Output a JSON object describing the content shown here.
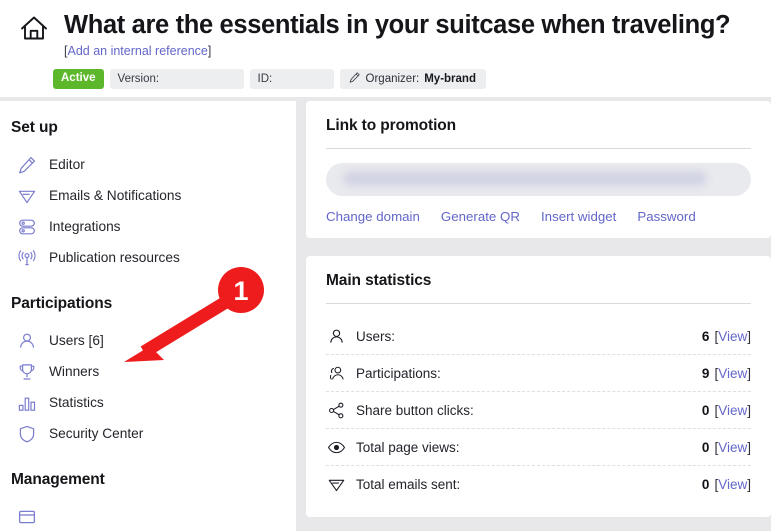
{
  "header": {
    "home_icon": "home-icon",
    "title": "What are the essentials in your suitcase when traveling?",
    "internal_ref_open": "[",
    "internal_ref_link": "Add an internal reference",
    "internal_ref_close": "]",
    "status_badge": "Active",
    "status_color": "#5cb82a",
    "version_label": "Version:",
    "id_label": "ID:",
    "organizer_icon": "pencil-icon",
    "organizer_label": "Organizer:",
    "organizer_value": "My-brand"
  },
  "sidebar": {
    "groups": [
      {
        "heading": "Set up",
        "items": [
          {
            "label": "Editor",
            "icon": "pencil-icon"
          },
          {
            "label": "Emails & Notifications",
            "icon": "paper-plane-icon"
          },
          {
            "label": "Integrations",
            "icon": "servers-icon"
          },
          {
            "label": "Publication resources",
            "icon": "broadcast-icon"
          }
        ]
      },
      {
        "heading": "Participations",
        "items": [
          {
            "label": "Users [6]",
            "icon": "user-icon"
          },
          {
            "label": "Winners",
            "icon": "trophy-icon"
          },
          {
            "label": "Statistics",
            "icon": "bar-chart-icon"
          },
          {
            "label": "Security Center",
            "icon": "shield-icon"
          }
        ]
      },
      {
        "heading": "Management",
        "items": [
          {
            "label": "",
            "icon": "window-icon"
          }
        ]
      }
    ]
  },
  "promotion_card": {
    "title": "Link to promotion",
    "url_value": "",
    "links": [
      {
        "label": "Change domain"
      },
      {
        "label": "Generate QR"
      },
      {
        "label": "Insert widget"
      },
      {
        "label": "Password"
      }
    ]
  },
  "statistics_card": {
    "title": "Main statistics",
    "view_open": "[",
    "view_label": "View",
    "view_close": "]",
    "rows": [
      {
        "label": "Users:",
        "value": "6",
        "icon": "user-icon"
      },
      {
        "label": "Participations:",
        "value": "9",
        "icon": "users-group-icon"
      },
      {
        "label": "Share button clicks:",
        "value": "0",
        "icon": "share-nodes-icon"
      },
      {
        "label": "Total page views:",
        "value": "0",
        "icon": "eye-icon"
      },
      {
        "label": "Total emails sent:",
        "value": "0",
        "icon": "paper-plane-icon"
      }
    ]
  },
  "annotation": {
    "step_number": "1",
    "color": "#ee1c1c"
  },
  "theme": {
    "accent": "#6366c9",
    "background": "#e8e8ea",
    "surface": "#ffffff",
    "text": "#16161a"
  }
}
